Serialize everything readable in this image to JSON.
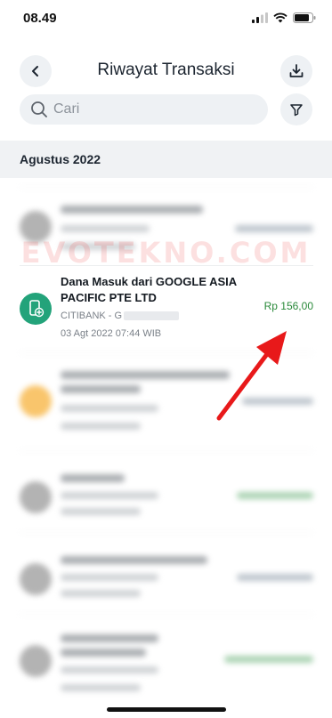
{
  "status": {
    "time": "08.49"
  },
  "header": {
    "title": "Riwayat Transaksi"
  },
  "search": {
    "placeholder": "Cari"
  },
  "month_label": "Agustus 2022",
  "watermark": "EVOTEKNO.COM",
  "transaction": {
    "title": "Dana Masuk dari GOOGLE ASIA PACIFIC PTE LTD",
    "bank": "CITIBANK - G",
    "datetime": "03 Agt 2022 07:44 WIB",
    "amount": "Rp 156,00"
  },
  "colors": {
    "accent_green": "#23a37a",
    "amount_green": "#2a8a3a",
    "annotation_arrow": "#e8191a"
  }
}
